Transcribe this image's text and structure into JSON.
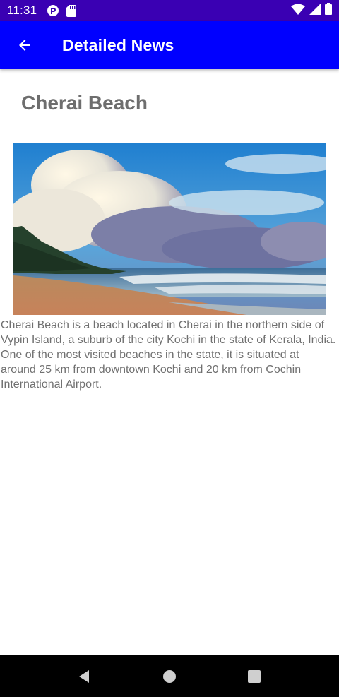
{
  "status_bar": {
    "time": "11:31",
    "icons": [
      "sync-icon",
      "sd-card-icon",
      "wifi-icon",
      "signal-icon",
      "battery-icon"
    ]
  },
  "app_bar": {
    "title": "Detailed News",
    "back_icon": "arrow-back-icon",
    "color": "#0000ff"
  },
  "article": {
    "title": "Cherai Beach",
    "image_subject": "beach-with-clouds",
    "body": "Cherai Beach is a beach located in Cherai in the northern side of Vypin Island, a suburb of the city Kochi in the state of Kerala, India. One of the most visited beaches in the state, it is situated at around 25 km from downtown Kochi and 20 km from Cochin International Airport."
  },
  "nav_bar": {
    "icons": [
      "back-triangle-icon",
      "home-circle-icon",
      "recents-square-icon"
    ]
  }
}
